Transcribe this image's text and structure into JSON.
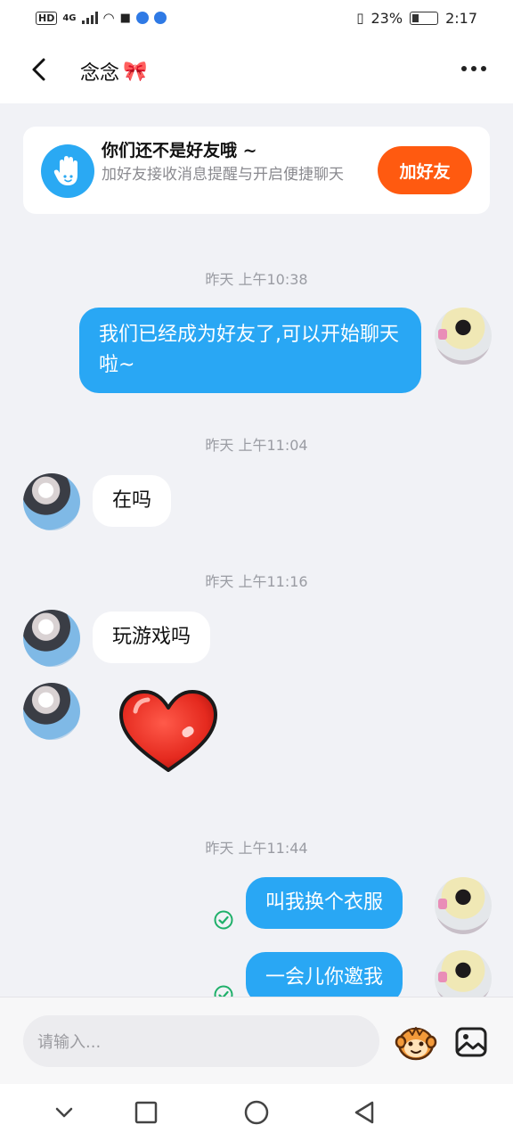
{
  "status_bar": {
    "hd": "HD",
    "network": "4G",
    "battery": "23%",
    "time": "2:17"
  },
  "header": {
    "title": "念念",
    "title_emoji": "🎀",
    "icons": [
      "back-icon",
      "more-icon"
    ]
  },
  "friend_card": {
    "title": "你们还不是好友哦 ~",
    "description": "加好友接收消息提醒与开启便捷聊天",
    "button": "加好友",
    "icon": "hand-icon"
  },
  "messages": [
    {
      "type": "time",
      "text": "昨天 上午10:38"
    },
    {
      "type": "out",
      "text": "我们已经成为好友了,可以开始聊天啦~"
    },
    {
      "type": "time",
      "text": "昨天 上午11:04"
    },
    {
      "type": "in",
      "text": "在吗"
    },
    {
      "type": "time",
      "text": "昨天 上午11:16"
    },
    {
      "type": "in",
      "text": "玩游戏吗"
    },
    {
      "type": "in",
      "sticker": "heart-sticker"
    },
    {
      "type": "time",
      "text": "昨天 上午11:44"
    },
    {
      "type": "out",
      "text": "叫我换个衣服",
      "status": "read-check"
    },
    {
      "type": "out",
      "text": "一会儿你邀我",
      "status": "read-check"
    }
  ],
  "input_bar": {
    "placeholder": "请输入...",
    "icons": [
      "monkey-emoji-icon",
      "image-icon"
    ]
  },
  "nav_bar": {
    "icons": [
      "chevron-down-icon",
      "recent-apps-icon",
      "home-icon",
      "back-triangle-icon"
    ]
  },
  "colors": {
    "accent_blue": "#29a7f4",
    "add_friend_orange": "#ff5a10",
    "background": "#f1f2f6",
    "check_green": "#1fb06a"
  }
}
